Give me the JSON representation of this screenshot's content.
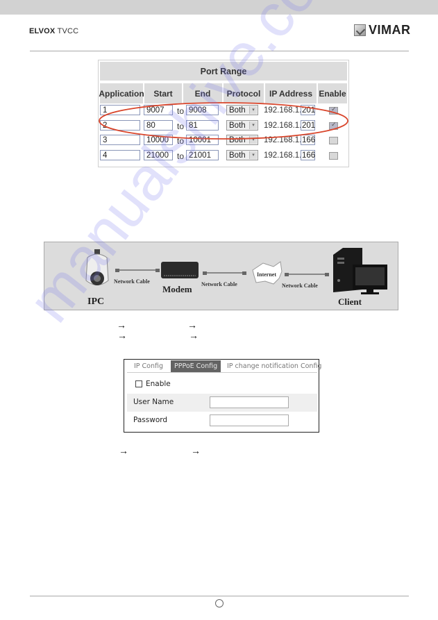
{
  "header": {
    "brand_left_bold": "ELVOX",
    "brand_left_light": "TVCC",
    "brand_right": "VIMAR"
  },
  "port_range": {
    "title": "Port Range",
    "columns": [
      "Application",
      "Start",
      "End",
      "Protocol",
      "IP Address",
      "Enable"
    ],
    "to_label": "to",
    "ip_prefix": "192.168.1.",
    "rows": [
      {
        "application": "1",
        "start": "9007",
        "end": "9008",
        "protocol": "Both",
        "ip_last": "201",
        "enabled": true
      },
      {
        "application": "2",
        "start": "80",
        "end": "81",
        "protocol": "Both",
        "ip_last": "201",
        "enabled": true
      },
      {
        "application": "3",
        "start": "10000",
        "end": "10001",
        "protocol": "Both",
        "ip_last": "166",
        "enabled": false
      },
      {
        "application": "4",
        "start": "21000",
        "end": "21001",
        "protocol": "Both",
        "ip_last": "166",
        "enabled": false
      }
    ],
    "highlight_color": "#d9462c"
  },
  "diagram": {
    "nodes": {
      "ipc": "IPC",
      "modem": "Modem",
      "internet": "Internet",
      "client": "Client"
    },
    "cables": [
      "Network Cable",
      "Network Cable",
      "Network Cable"
    ]
  },
  "arrows": {
    "symbol": "→"
  },
  "pppoe_panel": {
    "tabs": [
      {
        "label": "IP Config",
        "active": false
      },
      {
        "label": "PPPoE Config",
        "active": true
      },
      {
        "label": "IP change notification Config",
        "active": false
      }
    ],
    "enable_label": "Enable",
    "enable_checked": false,
    "fields": [
      {
        "label": "User Name",
        "value": ""
      },
      {
        "label": "Password",
        "value": ""
      }
    ]
  },
  "watermark": "manualshive.com"
}
